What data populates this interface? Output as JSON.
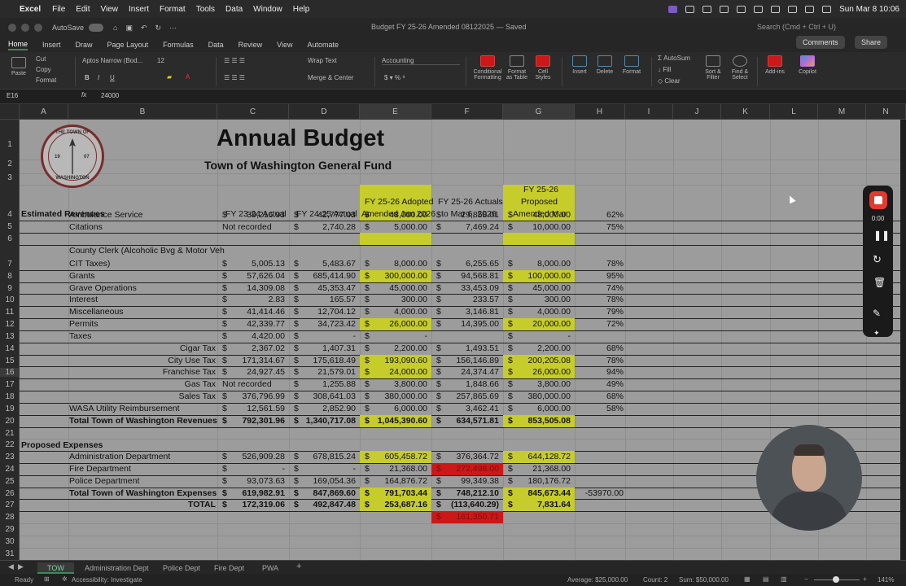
{
  "menubar": {
    "app": "Excel",
    "items": [
      "File",
      "Edit",
      "View",
      "Insert",
      "Format",
      "Tools",
      "Data",
      "Window",
      "Help"
    ],
    "clock": "Sun Mar 8  10:06"
  },
  "titlebar": {
    "autosave": "AutoSave",
    "document": "Budget FY 25-26 Amended 08122025 — Saved",
    "search_placeholder": "Search (Cmd + Ctrl + U)"
  },
  "ribbon_tabs": {
    "items": [
      "Home",
      "Insert",
      "Draw",
      "Page Layout",
      "Formulas",
      "Data",
      "Review",
      "View",
      "Automate"
    ],
    "comments": "Comments",
    "share": "Share"
  },
  "ribbon": {
    "paste": "Paste",
    "cut": "Cut",
    "copy": "Copy",
    "format": "Format",
    "font_name": "Aptos Narrow (Bod...",
    "font_size": "12",
    "wrap_text": "Wrap Text",
    "merge_center": "Merge & Center",
    "number_format": "Accounting",
    "conditional_formatting": "Conditional Formatting",
    "format_as_table": "Format as Table",
    "cell_styles": "Cell Styles",
    "insert": "Insert",
    "delete": "Delete",
    "format_cells": "Format",
    "autosum": "AutoSum",
    "fill": "Fill",
    "clear": "Clear",
    "sort_filter": "Sort & Filter",
    "find_select": "Find & Select",
    "addins": "Add-ins",
    "copilot": "Copilot"
  },
  "formula_bar": {
    "cell_ref": "E16",
    "fx": "fx",
    "value": "24000"
  },
  "columns": [
    "A",
    "B",
    "C",
    "D",
    "E",
    "F",
    "G",
    "H",
    "I",
    "J",
    "K",
    "L",
    "M",
    "N"
  ],
  "rows": [
    "1",
    "2",
    "3",
    "4",
    "5",
    "6",
    "7",
    "8",
    "9",
    "10",
    "11",
    "12",
    "13",
    "14",
    "15",
    "16",
    "17",
    "18",
    "19",
    "20",
    "21",
    "22",
    "23",
    "24",
    "25",
    "26",
    "27",
    "28",
    "29",
    "30",
    "31"
  ],
  "sheet": {
    "title": "Annual Budget",
    "subtitle": "Town of Washington General Fund",
    "logo_top": "THE TOWN OF",
    "logo_bottom": "WASHINGTON",
    "logo_year_left": "19",
    "logo_year_right": "07",
    "section_revenues": "Estimated Revenues",
    "headers": {
      "c": "FY 23-24 Actual",
      "d": "FY 24-25 Actual",
      "e1": "FY 25-26 Adopted",
      "e2": "Amended Jan 2026",
      "f1": "FY 25-26 Actuals",
      "f2": "to Mar 6, 2026",
      "g1": "FY 25-26",
      "g2": "Proposed",
      "g3": "Amended Mar"
    },
    "r5": {
      "b": "Ambulance Service",
      "c": "39,216.93",
      "d": "42,777.03",
      "e": "48,000.00",
      "f": "29,858.01",
      "g": "48,000.00",
      "h": "62%"
    },
    "r6": {
      "b": "Citations",
      "c": "Not recorded",
      "d": "2,740.28",
      "e": "5,000.00",
      "f": "7,469.24",
      "g": "10,000.00",
      "h": "75%"
    },
    "r7": {
      "b1": "County Clerk (Alcoholic Bvg & Motor Veh",
      "b2": "CIT Taxes)",
      "c": "5,005.13",
      "d": "5,483.67",
      "e": "8,000.00",
      "f": "6,255.65",
      "g": "8,000.00",
      "h": "78%"
    },
    "r8": {
      "b": "Grants",
      "c": "57,626.04",
      "d": "685,414.90",
      "e": "300,000.00",
      "f": "94,568.81",
      "g": "100,000.00",
      "h": "95%"
    },
    "r9": {
      "b": "Grave Operations",
      "c": "14,309.08",
      "d": "45,353.47",
      "e": "45,000.00",
      "f": "33,453.09",
      "g": "45,000.00",
      "h": "74%"
    },
    "r10": {
      "b": "Interest",
      "c": "2.83",
      "d": "165.57",
      "e": "300.00",
      "f": "233.57",
      "g": "300.00",
      "h": "78%"
    },
    "r11": {
      "b": "Miscellaneous",
      "c": "41,414.46",
      "d": "12,704.12",
      "e": "4,000.00",
      "f": "3,146.81",
      "g": "4,000.00",
      "h": "79%"
    },
    "r12": {
      "b": "Permits",
      "c": "42,339.77",
      "d": "34,723.42",
      "e": "26,000.00",
      "f": "14,395.00",
      "g": "20,000.00",
      "h": "72%"
    },
    "r13": {
      "b": "Taxes",
      "c": "4,420.00",
      "d": "-",
      "e": "-",
      "f": "",
      "g": "-",
      "h": ""
    },
    "r14": {
      "b": "Cigar Tax",
      "c": "2,367.02",
      "d": "1,407.31",
      "e": "2,200.00",
      "f": "1,493.51",
      "g": "2,200.00",
      "h": "68%"
    },
    "r15": {
      "b": "City Use Tax",
      "c": "171,314.67",
      "d": "175,618.49",
      "e": "193,090.60",
      "f": "156,146.89",
      "g": "200,205.08",
      "h": "78%"
    },
    "r16": {
      "b": "Franchise Tax",
      "c": "24,927.45",
      "d": "21,579.01",
      "e": "24,000.00",
      "f": "24,374.47",
      "g": "26,000.00",
      "h": "94%"
    },
    "r17": {
      "b": "Gas Tax",
      "c": "Not recorded",
      "d": "1,255.88",
      "e": "3,800.00",
      "f": "1,848.66",
      "g": "3,800.00",
      "h": "49%"
    },
    "r18": {
      "b": "Sales Tax",
      "c": "376,796.99",
      "d": "308,641.03",
      "e": "380,000.00",
      "f": "257,865.69",
      "g": "380,000.00",
      "h": "68%"
    },
    "r19": {
      "b": "WASA Utility Reimbursement",
      "c": "12,561.59",
      "d": "2,852.90",
      "e": "6,000.00",
      "f": "3,462.41",
      "g": "6,000.00",
      "h": "58%"
    },
    "r20": {
      "b": "Total Town of Washington Revenues",
      "c": "792,301.96",
      "d": "1,340,717.08",
      "e": "1,045,390.60",
      "f": "634,571.81",
      "g": "853,505.08"
    },
    "section_expenses": "Proposed Expenses",
    "r23": {
      "b": "Administration Department",
      "c": "526,909.28",
      "d": "678,815.24",
      "e": "605,458.72",
      "f": "376,364.72",
      "g": "644,128.72"
    },
    "r24": {
      "b": "Fire Department",
      "c": "-",
      "d": "-",
      "e": "21,368.00",
      "f": "272,498.00",
      "g": "21,368.00"
    },
    "r25": {
      "b": "Police Department",
      "c": "93,073.63",
      "d": "169,054.36",
      "e": "164,876.72",
      "f": "99,349.38",
      "g": "180,176.72"
    },
    "r26": {
      "b": "Total Town of Washington Expenses",
      "c": "619,982.91",
      "d": "847,869.60",
      "e": "791,703.44",
      "f": "748,212.10",
      "g": "845,673.44",
      "h": "-53970.00"
    },
    "r27": {
      "b": "TOTAL",
      "c": "172,319.06",
      "d": "492,847.48",
      "e": "253,687.16",
      "f": "(113,640.29)",
      "g": "7,831.64"
    },
    "r28": {
      "f": "161,350.71"
    },
    "dollar": "$"
  },
  "sheet_tabs": [
    "TOW",
    "Administration Dept",
    "Police Dept",
    "Fire Dept",
    "PWA"
  ],
  "status": {
    "ready": "Ready",
    "accessibility": "Accessibility: Investigate",
    "average": "Average: $25,000.00",
    "count": "Count: 2",
    "sum": "Sum: $50,000.00",
    "zoom": "141%"
  },
  "recorder": {
    "timer": "0:00"
  },
  "colors": {
    "highlight": "#c6cc2a",
    "alert": "#cc1818",
    "accent": "#3d8a5a",
    "record": "#e23b2e"
  }
}
